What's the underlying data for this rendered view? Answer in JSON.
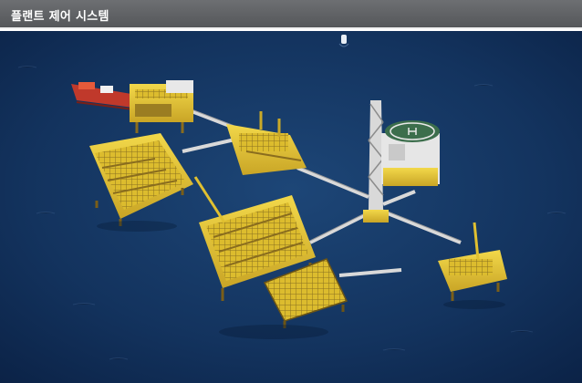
{
  "header": {
    "title": "플랜트 제어 시스템"
  },
  "photo": {
    "subject": "offshore-oil-platform-complex"
  },
  "colors": {
    "header_bg": "#5f6164",
    "sea": "#13335e",
    "structure": "#e3c431"
  }
}
